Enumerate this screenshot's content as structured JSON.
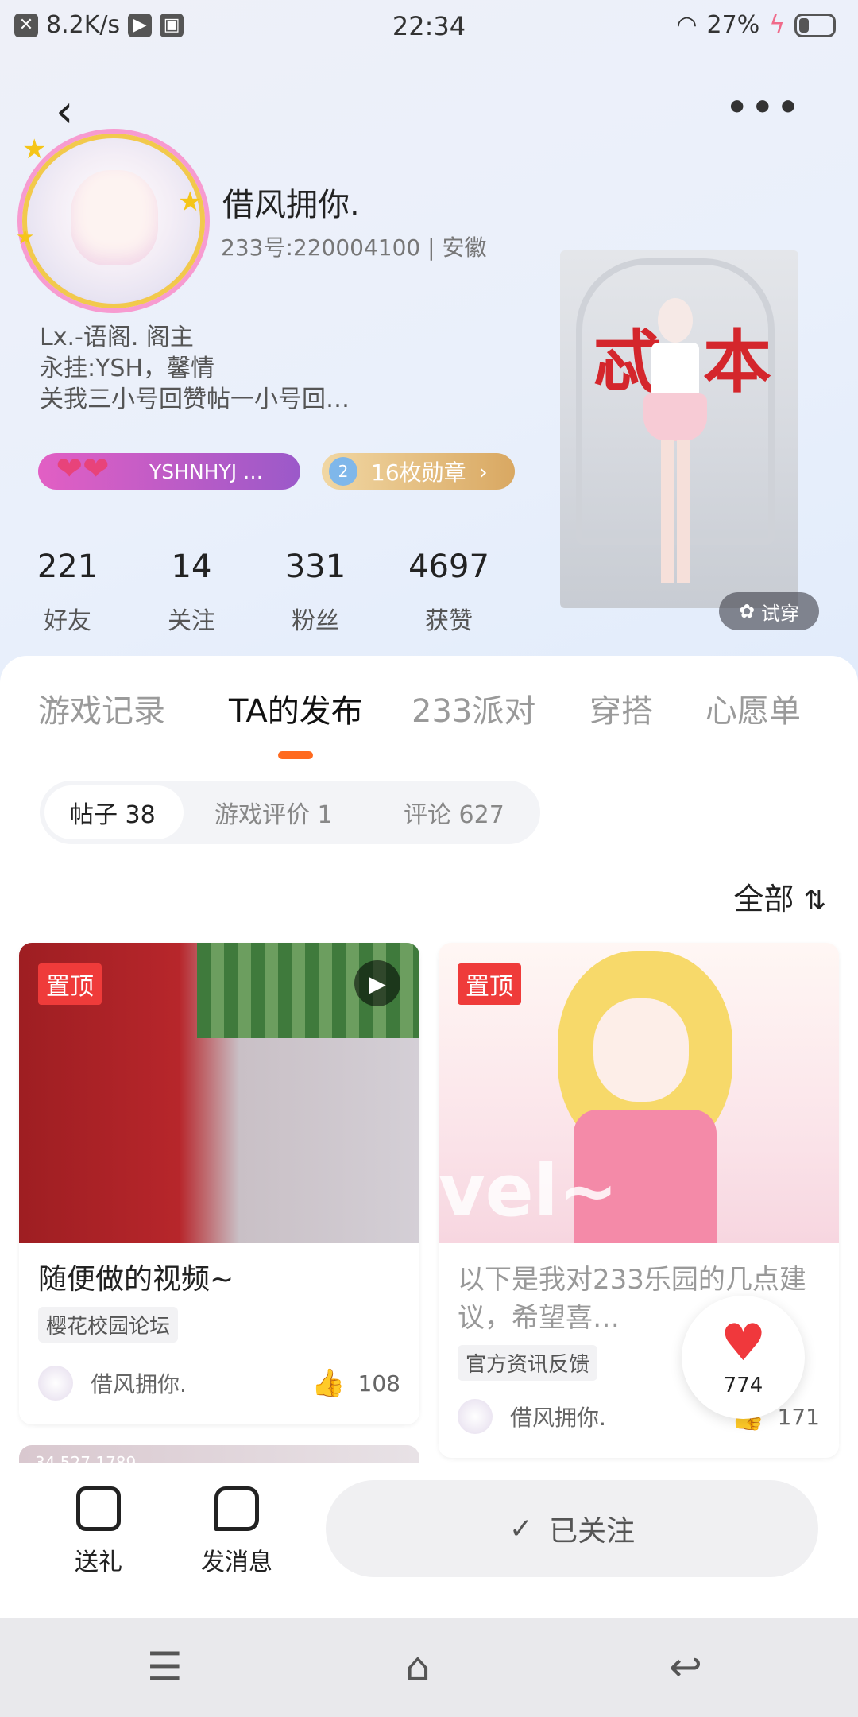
{
  "status_bar": {
    "net_speed": "8.2K/s",
    "time": "22:34",
    "battery": "27%"
  },
  "profile": {
    "username": "借风拥你.",
    "uid": "233号:220004100",
    "location": "安徽",
    "bio": [
      "Lx.-语阁.    阁主",
      "永挂:YSH，馨情",
      "关我三小号回赞帖一小号回…"
    ],
    "badge_name": "YSHNHYJ …",
    "medal_text": "16枚勋章",
    "medal_level": "2",
    "stats": [
      {
        "value": "221",
        "label": "好友"
      },
      {
        "value": "14",
        "label": "关注"
      },
      {
        "value": "331",
        "label": "粉丝"
      },
      {
        "value": "4697",
        "label": "获赞"
      }
    ],
    "tryon_label": "试穿"
  },
  "tabs": [
    "游戏记录",
    "TA的发布",
    "233派对",
    "穿搭",
    "心愿单"
  ],
  "active_tab": "TA的发布",
  "subtabs": [
    "帖子 38",
    "游戏评价 1",
    "评论 627"
  ],
  "filter_label": "全部",
  "posts": [
    {
      "pin": "置顶",
      "title": "随便做的视频~",
      "tag": "樱花校园论坛",
      "author": "借风拥你.",
      "likes": "108"
    },
    {
      "pin": "置顶",
      "title": "以下是我对233乐园的几点建议，希望喜…",
      "tag": "官方资讯反馈",
      "author": "借风拥你.",
      "likes": "171"
    }
  ],
  "card3_stats": "34   527   1789",
  "float_like_count": "774",
  "actions": {
    "gift": "送礼",
    "message": "发消息",
    "follow": "已关注"
  },
  "colors": {
    "accent": "#ff6a1f",
    "pin_red": "#ef3b3a",
    "heart_red": "#f0383c"
  }
}
